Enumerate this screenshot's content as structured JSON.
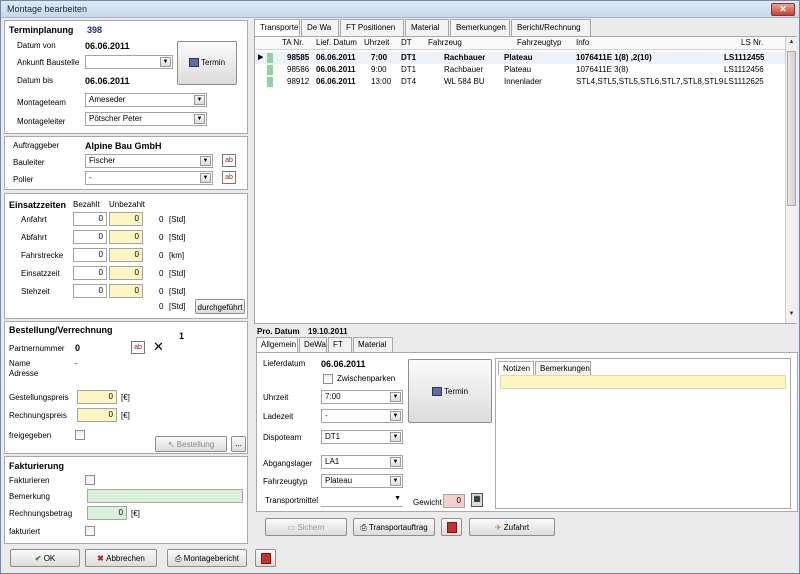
{
  "window": {
    "title": "Montage bearbeiten"
  },
  "terminplanung": {
    "heading": "Terminplanung",
    "number": "398",
    "datum_von_label": "Datum von",
    "datum_von": "06.06.2011",
    "ankunft_label": "Ankunft Baustelle",
    "ankunft_value": "",
    "datum_bis_label": "Datum bis",
    "datum_bis": "06.06.2011",
    "termin_btn": "Termin",
    "montageteam_label": "Montageteam",
    "montageteam": "Ameseder",
    "montageleiter_label": "Montageleiter",
    "montageleiter": "Pötscher Peter"
  },
  "auftraggeber": {
    "label": "Auftraggeber",
    "value": "Alpine Bau GmbH",
    "bauleiter_label": "Bauleiter",
    "bauleiter": "Fischer",
    "polier_label": "Polier",
    "polier": "-"
  },
  "einsatz": {
    "heading": "Einsatzzeiten",
    "bezahlt": "Bezahlt",
    "unbezahlt": "Unbezahlt",
    "rows": [
      {
        "label": "Anfahrt",
        "bezahlt": "0",
        "unbezahlt": "0",
        "total": "0",
        "unit": "[Std]"
      },
      {
        "label": "Abfahrt",
        "bezahlt": "0",
        "unbezahlt": "0",
        "total": "0",
        "unit": "[Std]"
      },
      {
        "label": "Fahrstrecke",
        "bezahlt": "0",
        "unbezahlt": "0",
        "total": "0",
        "unit": "[km]"
      },
      {
        "label": "Einsatzzeit",
        "bezahlt": "0",
        "unbezahlt": "0",
        "total": "0",
        "unit": "[Std]"
      },
      {
        "label": "Stehzeit",
        "bezahlt": "0",
        "unbezahlt": "0",
        "total": "0",
        "unit": "[Std]"
      }
    ],
    "sum_total": "0",
    "sum_unit": "[Std]",
    "durchgefuehrt_btn": "durchgeführt"
  },
  "bestellung": {
    "heading": "Bestellung/Verrechnung",
    "count": "1",
    "partnernummer_label": "Partnernummer",
    "partnernummer": "0",
    "name_label": "Name",
    "name": "-",
    "adresse_label": "Adresse",
    "gestellungspreis_label": "Gestellungspreis",
    "gestellungspreis": "0",
    "rechnungspreis_label": "Rechnungspreis",
    "rechnungspreis": "0",
    "currency": "[€]",
    "freigegeben_label": "freigegeben",
    "bestellung_btn": "Bestellung",
    "more_btn": "..."
  },
  "fakturierung": {
    "heading": "Fakturierung",
    "fakturieren_label": "Fakturieren",
    "bemerkung_label": "Bemerkung",
    "bemerkung": "",
    "rechnungsbetrag_label": "Rechnungsbetrag",
    "rechnungsbetrag": "0",
    "currency": "[€]",
    "fakturiert_label": "fakturiert"
  },
  "top_tabs": [
    "Transporte",
    "De Wa",
    "FT Positionen",
    "Material",
    "Bemerkungen",
    "Bericht/Rechnung"
  ],
  "transport_table": {
    "headers": [
      "TA Nr.",
      "Lief. Datum",
      "Uhrzeit",
      "DT",
      "Fahrzeug",
      "Fahrzeugtyp",
      "Info",
      "LS Nr."
    ],
    "rows": [
      {
        "ta": "98585",
        "datum": "06.06.2011",
        "uhrzeit": "7:00",
        "dt": "DT1",
        "fahrzeug": "Rachbauer",
        "typ": "Plateau",
        "info": "1076411E 1(8) ,2(10)",
        "ls": "LS1112455"
      },
      {
        "ta": "98586",
        "datum": "06.06.2011",
        "uhrzeit": "9:00",
        "dt": "DT1",
        "fahrzeug": "Rachbauer",
        "typ": "Plateau",
        "info": "1076411E 3(8)",
        "ls": "LS1112456"
      },
      {
        "ta": "98912",
        "datum": "06.06.2011",
        "uhrzeit": "13:00",
        "dt": "DT4",
        "fahrzeug": "WL 584 BU",
        "typ": "Innenlader",
        "info": "STL4,STL5,STL5,STL6,STL7,STL8,STL9",
        "ls": "LS1112625"
      }
    ]
  },
  "detail": {
    "pro_datum_label": "Pro. Datum",
    "pro_datum": "19.10.2011",
    "tabs": [
      "Allgemein",
      "DeWa",
      "FT",
      "Material"
    ],
    "lieferdatum_label": "Lieferdatum",
    "lieferdatum": "06.06.2011",
    "zwischenparken_label": "Zwischenparken",
    "uhrzeit_label": "Uhrzeit",
    "uhrzeit": "7:00",
    "ladezeit_label": "Ladezeit",
    "ladezeit": "-",
    "dispoteam_label": "Dispoteam",
    "dispoteam": "DT1",
    "abgangslager_label": "Abgangslager",
    "abgangslager": "LA1",
    "fahrzeugtyp_label": "Fahrzeugtyp",
    "fahrzeugtyp": "Plateau",
    "transportmittel_label": "Transportmittel",
    "transportmittel": "",
    "gewicht_label": "Gewicht",
    "gewicht": "0",
    "termin_btn": "Termin",
    "notes_tabs": [
      "Notizen",
      "Bemerkungen"
    ]
  },
  "actions": {
    "sichern": "Sichern",
    "transportauftrag": "Transportauftrag",
    "zufahrt": "Zufahrt"
  },
  "footer": {
    "ok": "OK",
    "abbrechen": "Abbrechen",
    "montagebericht": "Montagebericht"
  }
}
